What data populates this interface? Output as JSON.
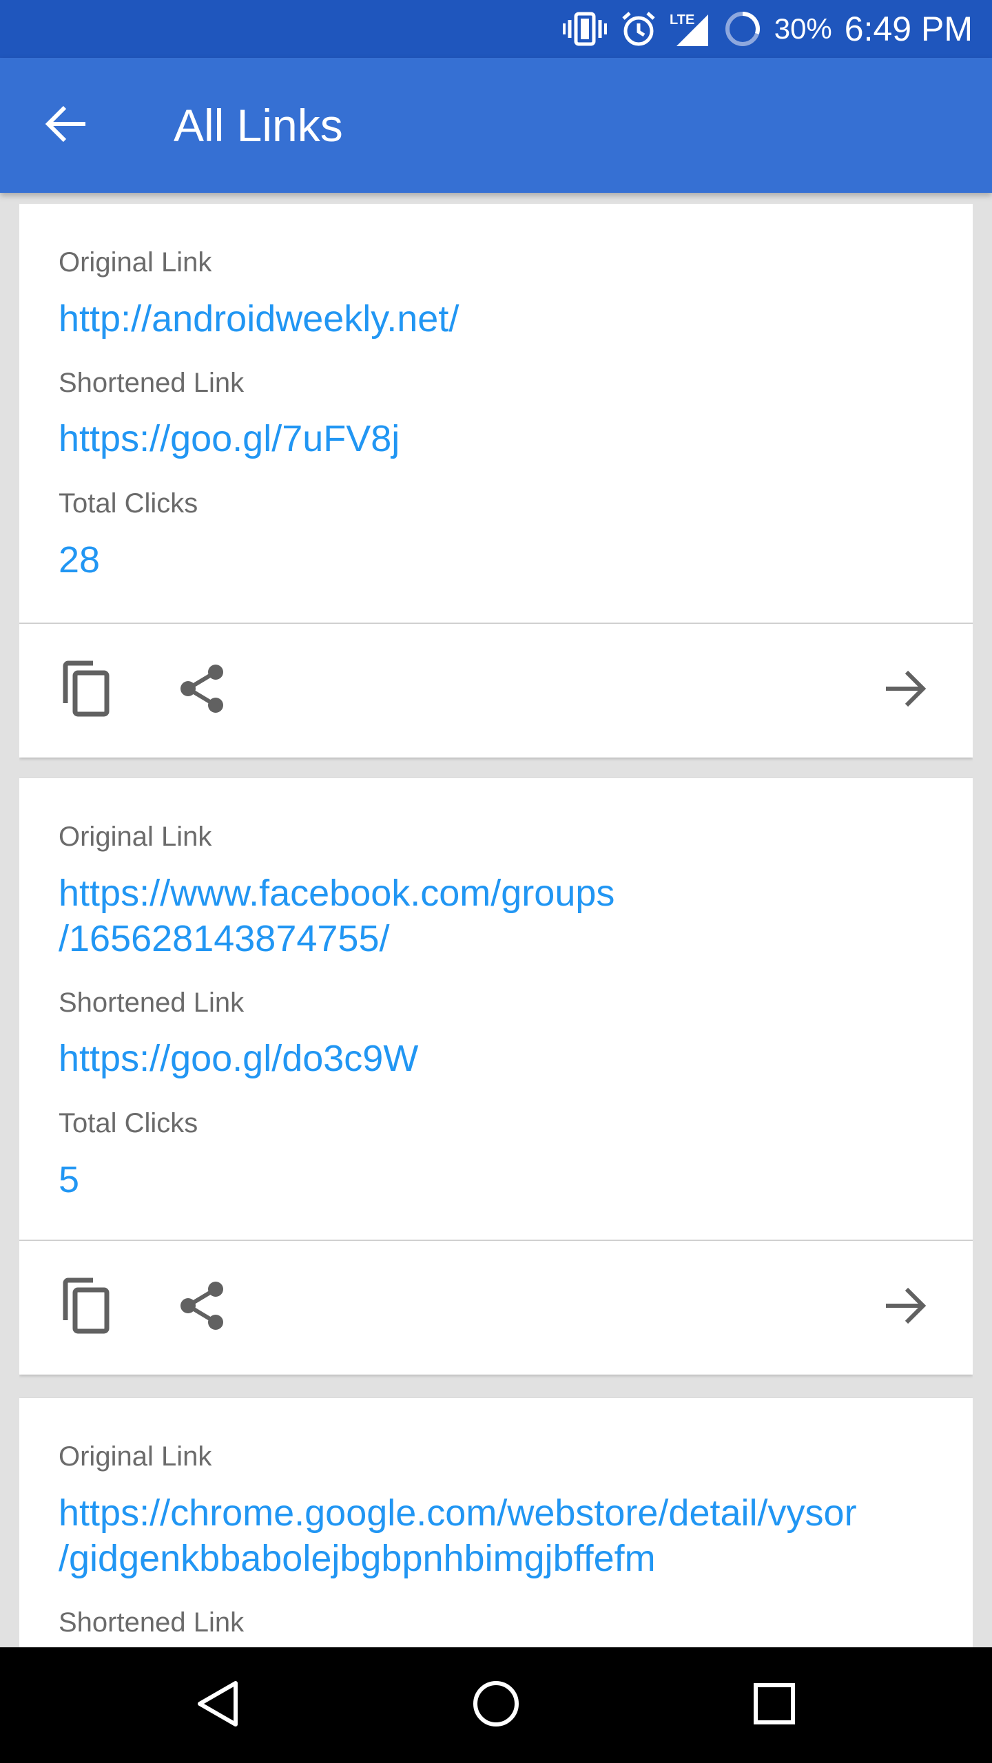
{
  "status_bar": {
    "battery": "30%",
    "time": "6:49 PM",
    "network": "LTE",
    "icons": [
      "vibrate-icon",
      "alarm-icon",
      "lte-signal-icon",
      "battery-icon"
    ]
  },
  "app_bar": {
    "title": "All Links",
    "back_icon": "arrow-back-icon",
    "color": "#3670d3",
    "status_color": "#1f56bd"
  },
  "colors": {
    "link": "#2196f3",
    "label": "#6b6b6b",
    "icon": "#616161"
  },
  "cards": [
    {
      "original_label": "Original Link",
      "original_value": "http://androidweekly.net/",
      "shortened_label": "Shortened Link",
      "shortened_value": "https://goo.gl/7uFV8j",
      "clicks_label": "Total Clicks",
      "clicks_value": "28",
      "actions": [
        "copy-icon",
        "share-icon",
        "arrow-forward-icon"
      ]
    },
    {
      "original_label": "Original Link",
      "original_value_line1": "https://www.facebook.com/groups",
      "original_value_line2": "/165628143874755/",
      "shortened_label": "Shortened Link",
      "shortened_value": "https://goo.gl/do3c9W",
      "clicks_label": "Total Clicks",
      "clicks_value": "5",
      "actions": [
        "copy-icon",
        "share-icon",
        "arrow-forward-icon"
      ]
    },
    {
      "original_label": "Original Link",
      "original_value_line1": "https://chrome.google.com/webstore/detail/vysor",
      "original_value_line2": "/gidgenkbbabolejbgbpnhbimgjbffefm",
      "shortened_label": "Shortened Link"
    }
  ],
  "nav_bar": {
    "icons": [
      "back-triangle-icon",
      "home-circle-icon",
      "recents-square-icon"
    ]
  }
}
